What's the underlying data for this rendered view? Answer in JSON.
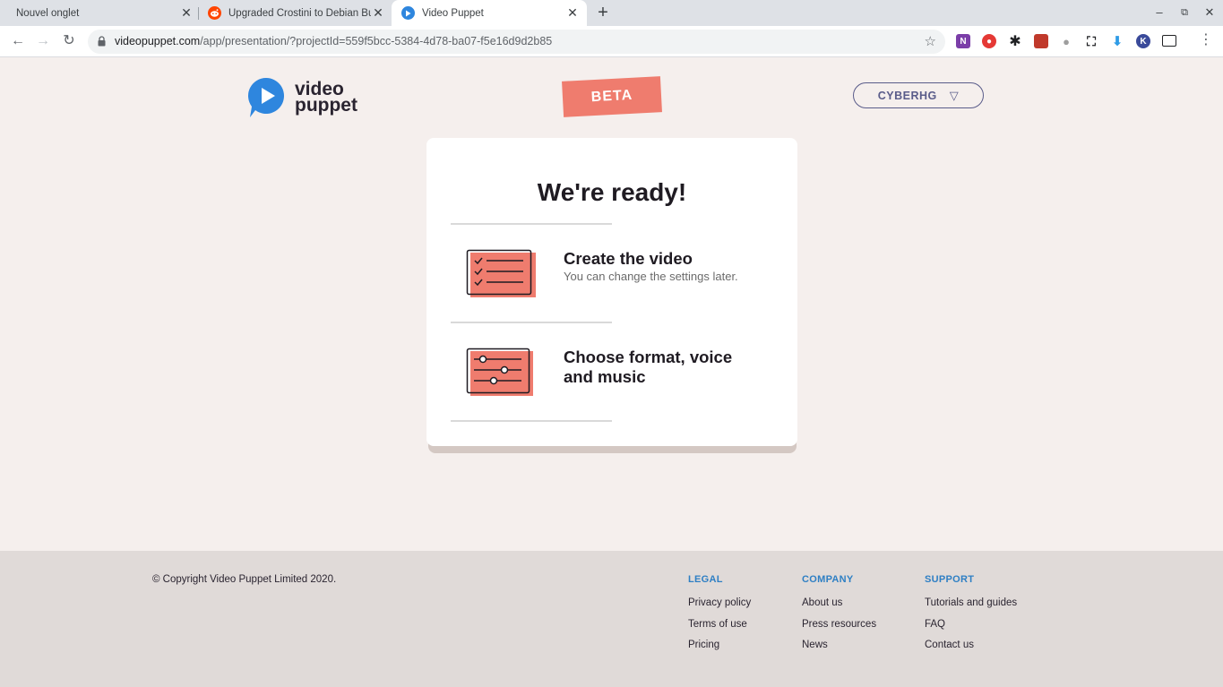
{
  "browser": {
    "tabs": [
      {
        "title": "Nouvel onglet",
        "icon": "none"
      },
      {
        "title": "Upgraded Crostini to Debian Bus",
        "icon": "reddit-icon"
      },
      {
        "title": "Video Puppet",
        "icon": "video-puppet-icon",
        "active": true
      }
    ],
    "url_host": "videopuppet.com",
    "url_path": "/app/presentation/?projectId=559f5bcc-5384-4d78-ba07-f5e16d9d2b85",
    "colors": {
      "tabstrip": "#dee1e6",
      "omnibox": "#f1f3f4"
    }
  },
  "header": {
    "logo_line1": "video",
    "logo_line2": "puppet",
    "beta": "BETA",
    "user": "CYBERHG"
  },
  "card": {
    "title": "We're ready!",
    "step1_title": "Create the video",
    "step1_sub": "You can change the settings later.",
    "step2_title_line1": "Choose format, voice",
    "step2_title_line2": "and music"
  },
  "footer": {
    "copyright": "© Copyright Video Puppet Limited 2020.",
    "legal": {
      "heading": "LEGAL",
      "links": [
        "Privacy policy",
        "Terms of use",
        "Pricing"
      ]
    },
    "company": {
      "heading": "COMPANY",
      "links": [
        "About us",
        "Press resources",
        "News"
      ]
    },
    "support": {
      "heading": "SUPPORT",
      "links": [
        "Tutorials and guides",
        "FAQ",
        "Contact us"
      ]
    }
  },
  "colors": {
    "accent": "#ef7c6e",
    "brand_blue": "#2e7fc4",
    "page_bg": "#f5efed",
    "footer_bg": "#e0dad8"
  }
}
